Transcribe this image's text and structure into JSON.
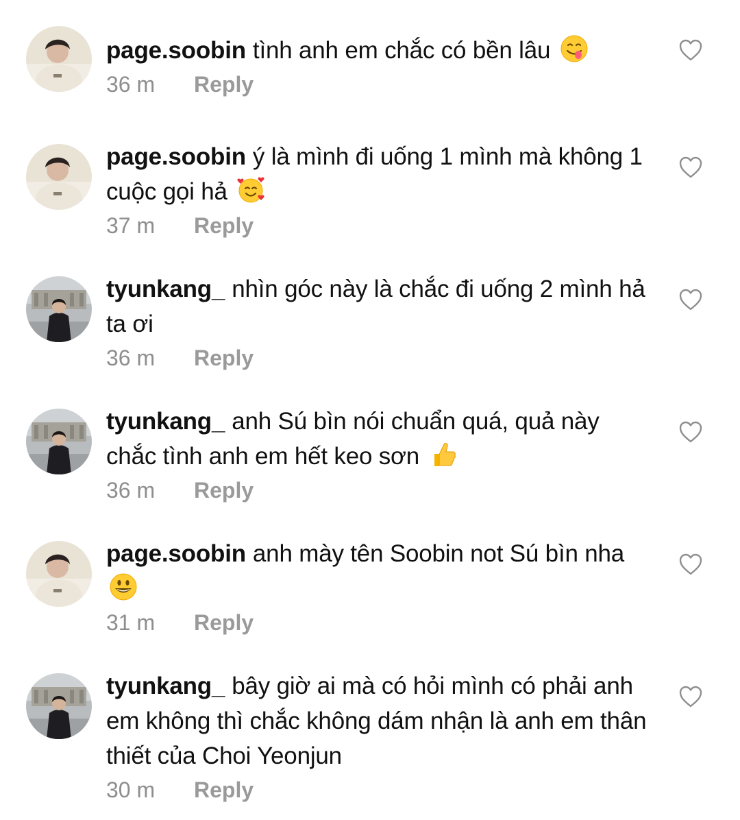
{
  "comments": [
    {
      "username": "page.soobin",
      "text": "tình anh em chắc có bền lâu",
      "emoji": "yum-face-emoji",
      "time": "36 m",
      "reply": "Reply"
    },
    {
      "username": "page.soobin",
      "text": "ý là mình đi uống 1 mình mà không 1 cuộc gọi hả",
      "emoji": "smiling-face-with-hearts-emoji",
      "time": "37 m",
      "reply": "Reply"
    },
    {
      "username": "tyunkang_",
      "text": "nhìn góc này là chắc đi uống 2 mình hả ta ơi",
      "time": "36 m",
      "reply": "Reply"
    },
    {
      "username": "tyunkang_",
      "text": "anh Sú bìn nói chuẩn quá, quả này chắc tình anh em hết keo sơn",
      "emoji": "thumbs-up-emoji",
      "time": "36 m",
      "reply": "Reply"
    },
    {
      "username": "page.soobin",
      "text": "anh mày tên Soobin not Sú bìn nha",
      "emoji": "grinning-face-emoji",
      "time": "31 m",
      "reply": "Reply"
    },
    {
      "username": "tyunkang_",
      "text": "bây giờ ai mà có hỏi mình có phải anh em không thì chắc không dám nhận là anh em thân thiết của Choi Yeonjun",
      "time": "30 m",
      "reply": "Reply"
    }
  ],
  "colors": {
    "text": "#111111",
    "meta": "#8e8e8e",
    "like_icon": "#8e8e8e",
    "background": "#ffffff"
  },
  "icons": {
    "like": "heart-outline-icon"
  }
}
